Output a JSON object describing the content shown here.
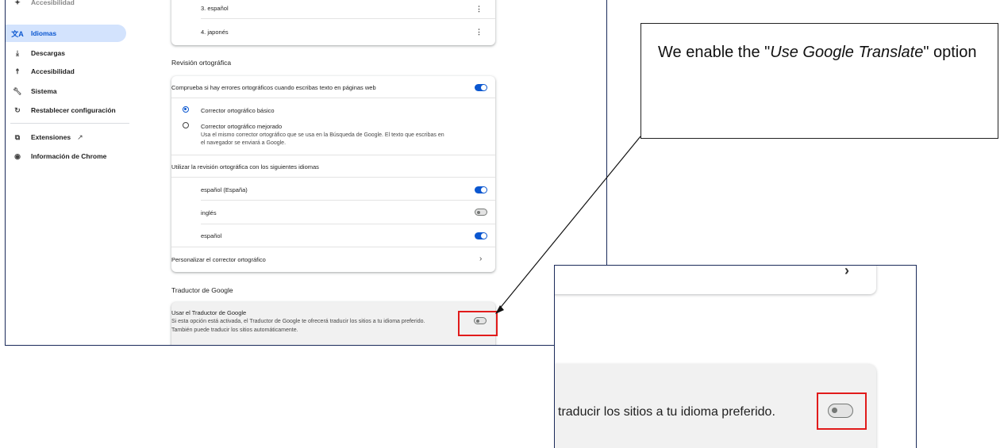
{
  "sidebar": {
    "top_partial": "Accesibilidad",
    "items": [
      {
        "label": "Idiomas",
        "icon": "translate-icon",
        "active": true
      },
      {
        "label": "Descargas",
        "icon": "download-icon"
      },
      {
        "label": "Accesibilidad",
        "icon": "accessibility-icon"
      },
      {
        "label": "Sistema",
        "icon": "wrench-icon"
      },
      {
        "label": "Restablecer configuración",
        "icon": "reset-icon"
      },
      {
        "label": "Extensiones",
        "icon": "puzzle-icon"
      },
      {
        "label": "Información de Chrome",
        "icon": "chrome-icon"
      }
    ]
  },
  "languages": {
    "item3": "3. español",
    "item4": "4. japonés"
  },
  "spellcheck": {
    "title": "Revisión ortográfica",
    "toggle_label": "Comprueba si hay errores ortográficos cuando escribas texto en páginas web",
    "basic": "Corrector ortográfico básico",
    "enhanced": "Corrector ortográfico mejorado",
    "enhanced_desc": "Usa el mismo corrector ortográfico que se usa en la Búsqueda de Google. El texto que escribas en el navegador se enviará a Google.",
    "languages_label": "Utilizar la revisión ortográfica con los siguientes idiomas",
    "lang1": "español (España)",
    "lang2": "inglés",
    "lang3": "español",
    "customize": "Personalizar el corrector ortográfico"
  },
  "translate": {
    "title": "Traductor de Google",
    "label": "Usar el Traductor de Google",
    "desc1": "Si esta opción está activada, el Traductor de Google te ofrecerá traducir los sitios a tu idioma preferido.",
    "desc2": "También puede traducir los sitios automáticamente."
  },
  "callout": {
    "text_before": "We enable the \"",
    "text_italic": "Use Google Translate",
    "text_after": "\" option"
  },
  "zoom": {
    "text": "traducir los sitios a tu idioma preferido."
  },
  "colors": {
    "accent": "#0b57d0",
    "highlight_box": "#e11b1b",
    "frame": "#1a2a5a"
  }
}
